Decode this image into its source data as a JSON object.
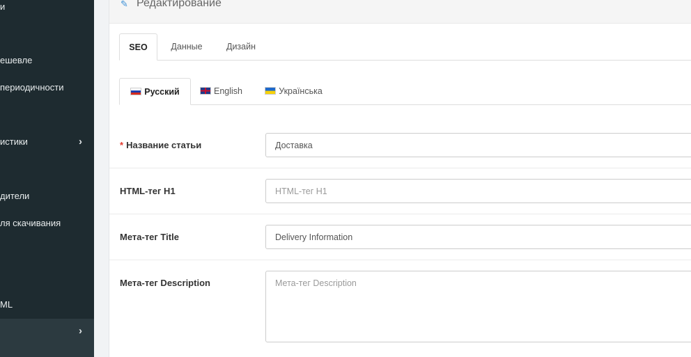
{
  "sidebar": {
    "items": [
      {
        "label": "и",
        "top": 0
      },
      {
        "label": "ешевле"
      },
      {
        "label": " периодичности"
      },
      {
        "label": "истики",
        "chevron": "›"
      },
      {
        "label": "дители"
      },
      {
        "label": "ля скачивания"
      },
      {
        "label": "ML"
      },
      {
        "label": "",
        "chevron": "›"
      }
    ]
  },
  "header": {
    "title": "Редактирование",
    "icon": "pencil-icon"
  },
  "tabs_main": [
    "SEO",
    "Данные",
    "Дизайн"
  ],
  "tabs_lang": [
    "Русский",
    "English",
    "Українська"
  ],
  "form": {
    "name": {
      "label": "Название статьи",
      "required_mark": "*",
      "value": "Доставка"
    },
    "h1": {
      "label": "HTML-тег H1",
      "placeholder": "HTML-тег H1",
      "value": ""
    },
    "meta_title": {
      "label": "Мета-тег Title",
      "value": "Delivery Information"
    },
    "meta_description": {
      "label": "Мета-тег Description",
      "placeholder": "Мета-тег Description",
      "value": ""
    }
  },
  "colors": {
    "sidebar_bg": "#1e2b30",
    "accent": "#3a8fd6",
    "required": "#e3372b"
  }
}
